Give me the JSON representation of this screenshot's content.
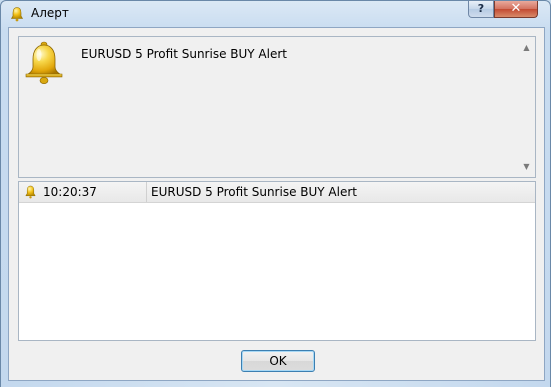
{
  "window": {
    "title": "Алерт",
    "help_label": "?",
    "close_label": "✕"
  },
  "message": {
    "text": "EURUSD 5 Profit Sunrise BUY Alert"
  },
  "history": {
    "rows": [
      {
        "time": "10:20:37",
        "message": "EURUSD 5 Profit Sunrise BUY Alert"
      }
    ]
  },
  "buttons": {
    "ok_label": "OK"
  },
  "icons": {
    "title": "bell-icon",
    "message": "bell-icon",
    "row": "bell-icon"
  },
  "colors": {
    "bell_gold": "#f4c21a",
    "selection_border": "#3c7fb1"
  }
}
